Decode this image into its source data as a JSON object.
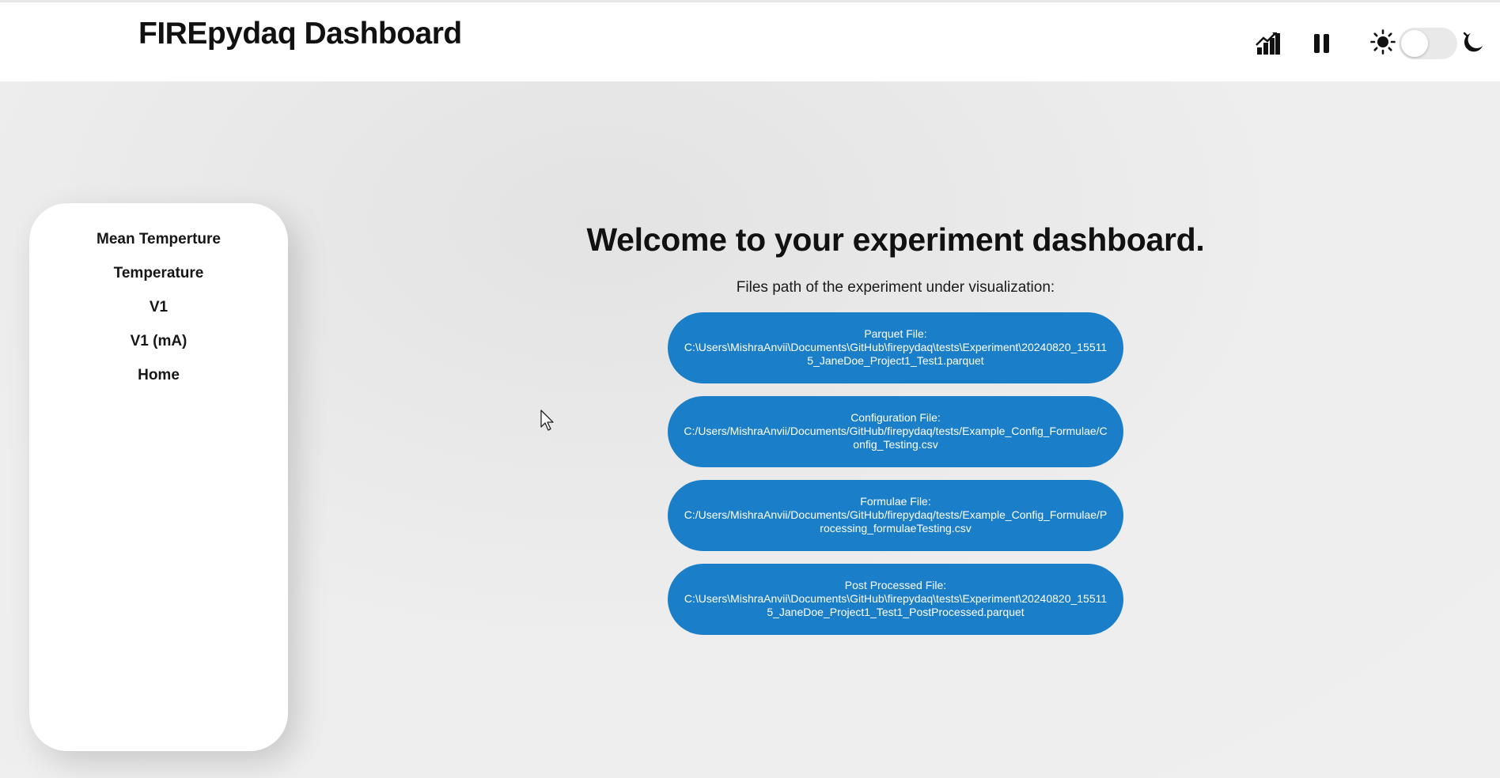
{
  "header": {
    "title": "FIREpydaq Dashboard",
    "icons": [
      "graph-signal-icon",
      "pause-icon",
      "sun-icon",
      "moon-icon"
    ],
    "theme_toggle": "light"
  },
  "sidebar": {
    "items": [
      {
        "label": "Mean Temperture"
      },
      {
        "label": "Temperature"
      },
      {
        "label": "V1"
      },
      {
        "label": "V1 (mA)"
      },
      {
        "label": "Home"
      }
    ]
  },
  "main": {
    "welcome": "Welcome to your experiment dashboard.",
    "subtitle": "Files path of the experiment under visualization:",
    "files": [
      {
        "label": "Parquet File:",
        "path": "C:\\Users\\MishraAnvii\\Documents\\GitHub\\firepydaq\\tests\\Experiment\\20240820_155115_JaneDoe_Project1_Test1.parquet"
      },
      {
        "label": "Configuration File:",
        "path": "C:/Users/MishraAnvii/Documents/GitHub/firepydaq/tests/Example_Config_Formulae/Config_Testing.csv"
      },
      {
        "label": "Formulae File:",
        "path": "C:/Users/MishraAnvii/Documents/GitHub/firepydaq/tests/Example_Config_Formulae/Processing_formulaeTesting.csv"
      },
      {
        "label": "Post Processed File:",
        "path": "C:\\Users\\MishraAnvii\\Documents\\GitHub\\firepydaq\\tests\\Experiment\\20240820_155115_JaneDoe_Project1_Test1_PostProcessed.parquet"
      }
    ]
  },
  "colors": {
    "accent": "#1a7ec9",
    "background": "#ededed",
    "panel": "#ffffff"
  }
}
